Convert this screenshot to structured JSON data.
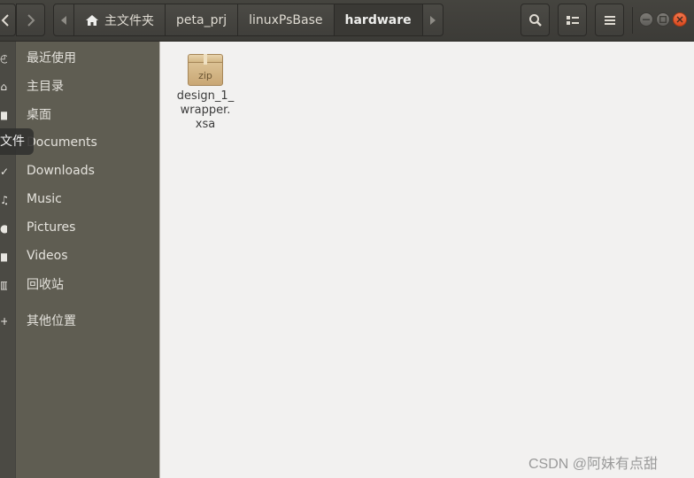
{
  "headerbar": {
    "back_icon": "chevron-left-icon",
    "forward_icon": "chevron-right-icon",
    "path_scroll_left_icon": "triangle-left-icon",
    "path_scroll_right_icon": "triangle-right-icon",
    "breadcrumbs": [
      {
        "label": "主文件夹",
        "icon": "home-icon"
      },
      {
        "label": "peta_prj"
      },
      {
        "label": "linuxPsBase"
      },
      {
        "label": "hardware",
        "active": true
      }
    ],
    "search_icon": "search-icon",
    "view_icon": "list-view-icon",
    "menu_icon": "hamburger-menu-icon",
    "window_controls": {
      "min_color": "#6f6d68",
      "max_color": "#6f6d68",
      "close_color": "#e45c2f"
    }
  },
  "tooltip": {
    "text": "文件"
  },
  "sidebar": {
    "items": [
      {
        "label": "最近使用",
        "icon": "clock-icon"
      },
      {
        "label": "主目录",
        "icon": "home-icon"
      },
      {
        "label": "桌面",
        "icon": "desktop-icon"
      },
      {
        "label": "Documents",
        "icon": "documents-icon"
      },
      {
        "label": "Downloads",
        "icon": "downloads-icon"
      },
      {
        "label": "Music",
        "icon": "music-icon"
      },
      {
        "label": "Pictures",
        "icon": "pictures-icon"
      },
      {
        "label": "Videos",
        "icon": "videos-icon"
      },
      {
        "label": "回收站",
        "icon": "trash-icon"
      },
      {
        "label": "其他位置",
        "icon": "plus-icon"
      }
    ]
  },
  "content": {
    "files": [
      {
        "name": "design_1_wrapper.xsa",
        "display_name": "design_1_ wrapper. xsa",
        "icon": "zip-archive-icon",
        "icon_label": "zip"
      }
    ]
  },
  "watermark": {
    "text": "CSDN @阿妹有点甜"
  }
}
